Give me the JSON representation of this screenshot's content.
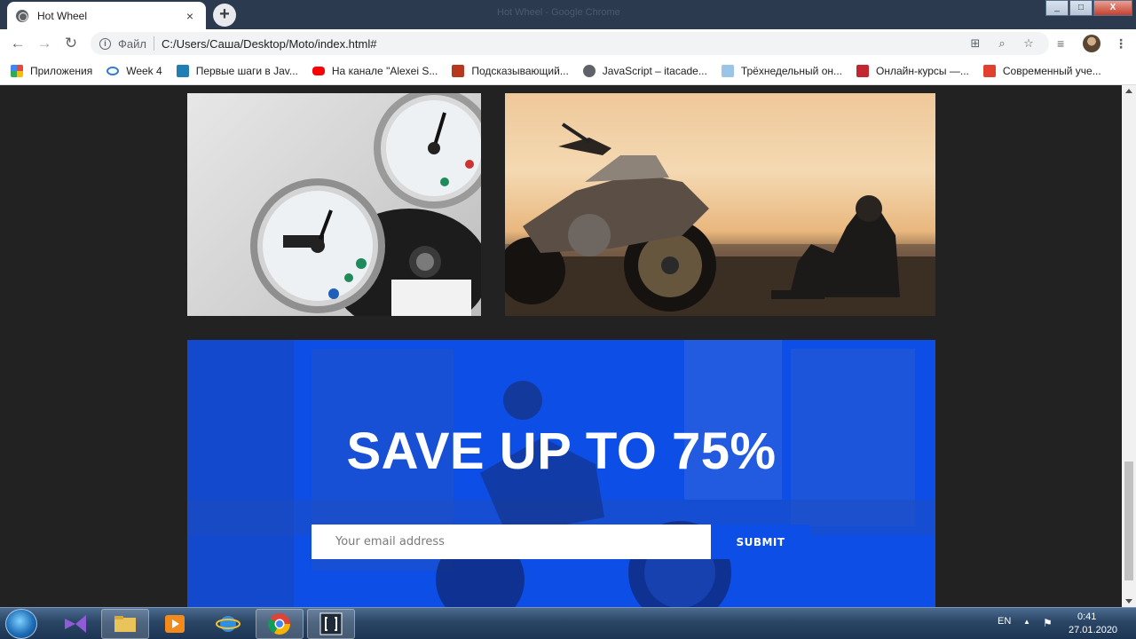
{
  "browser": {
    "tab_title": "Hot Wheel",
    "tab_close": "×",
    "new_tab": "+",
    "window_title_faint": "Hot Wheel - Google Chrome",
    "window_controls": {
      "minimize": "_",
      "maximize": "□",
      "close": "X"
    },
    "nav": {
      "back": "←",
      "forward": "→",
      "reload": "↻"
    },
    "address": {
      "info": "i",
      "scheme_label": "Файл",
      "url": "C:/Users/Саша/Desktop/Moto/index.html#"
    },
    "toolbar_icons": [
      "translate-icon",
      "zoom-icon",
      "star-icon",
      "media-icon",
      "avatar",
      "menu-icon"
    ],
    "bookmarks": [
      {
        "label": "Приложения",
        "icon": "apps-icon",
        "color": "#e24a3c"
      },
      {
        "label": "Week 4",
        "icon": "infinity-icon",
        "color": "#2f7bd6"
      },
      {
        "label": "Первые шаги в Jav...",
        "icon": "bookmark-icon",
        "color": "#1f7fb3"
      },
      {
        "label": "На канале \"Alexei S...",
        "icon": "youtube-icon",
        "color": "#ff0000"
      },
      {
        "label": "Подсказывающий...",
        "icon": "grid-icon",
        "color": "#b5381f"
      },
      {
        "label": "JavaScript – itacade...",
        "icon": "globe-icon",
        "color": "#5f6368"
      },
      {
        "label": "Трёхнедельный он...",
        "icon": "brand-icon",
        "color": "#9cc3e8"
      },
      {
        "label": "Онлайн-курсы —...",
        "icon": "brand-icon",
        "color": "#c2262e"
      },
      {
        "label": "Современный уче...",
        "icon": "brand-icon",
        "color": "#e2402f"
      }
    ]
  },
  "page": {
    "promo": {
      "heading": "SAVE UP TO 75%",
      "email_placeholder": "Your email address",
      "submit_label": "SUBMIT"
    }
  },
  "taskbar": {
    "language": "EN",
    "time": "0:41",
    "date": "27.01.2020"
  },
  "colors": {
    "promo_blue": "#0d4ee6",
    "page_bg": "#222222"
  }
}
